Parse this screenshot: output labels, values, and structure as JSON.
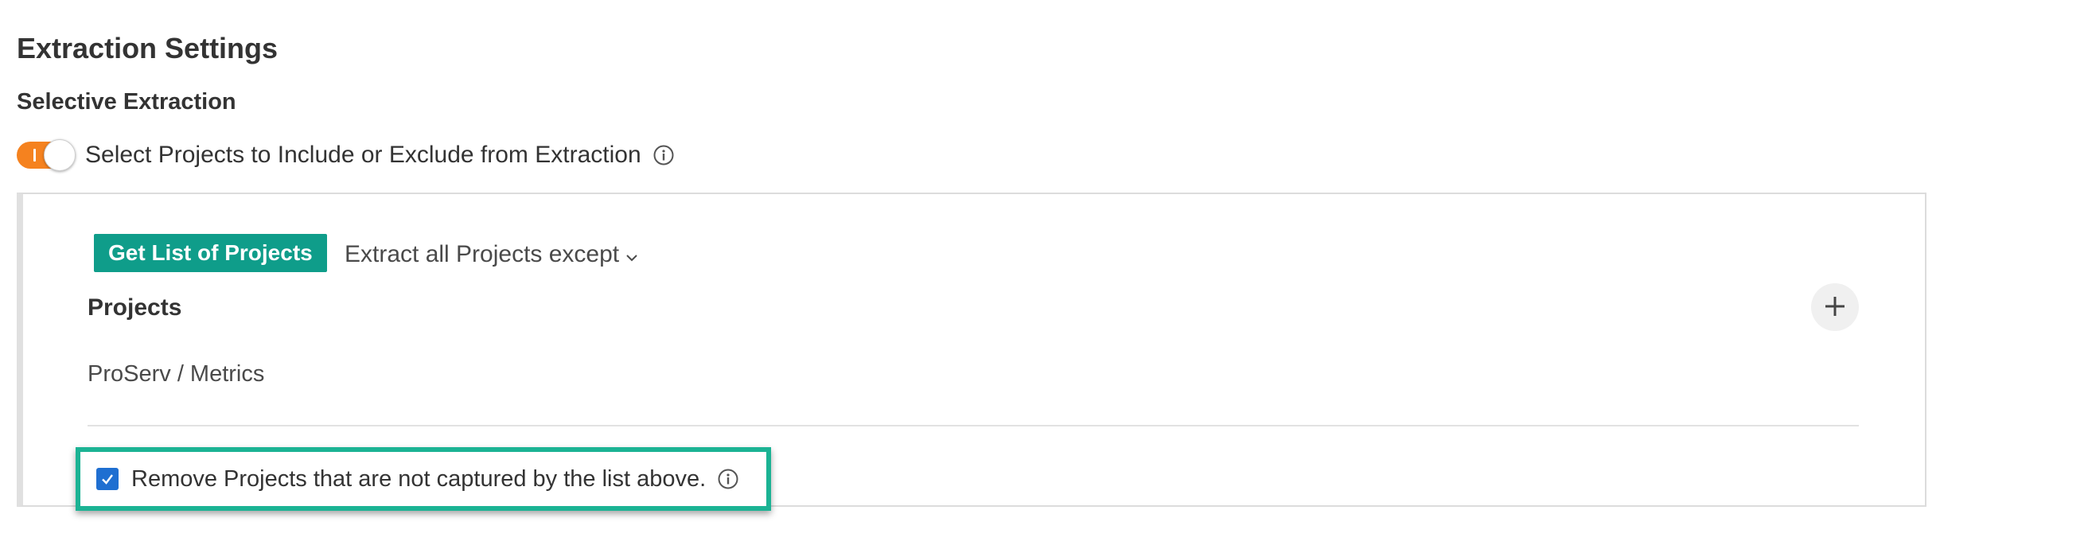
{
  "settings": {
    "title": "Extraction Settings",
    "subtitle": "Selective Extraction"
  },
  "toggle": {
    "label": "Select Projects to Include or Exclude from Extraction",
    "state": "on",
    "color": "#f5821f"
  },
  "panel": {
    "get_list_button": "Get List of Projects",
    "button_color": "#0f9d8a",
    "mode_dropdown": {
      "selected": "Extract all Projects except",
      "icon": "chevron-down-icon"
    },
    "projects_heading": "Projects",
    "add_icon": "plus-icon",
    "projects": [
      {
        "name": "ProServ / Metrics"
      }
    ],
    "remove_option": {
      "label": "Remove Projects that are not captured by the list above.",
      "checked": true,
      "checkbox_color": "#1f6fd1",
      "highlight_color": "#1bb394"
    }
  },
  "icons": {
    "info": "info-icon",
    "check": "check-icon"
  }
}
